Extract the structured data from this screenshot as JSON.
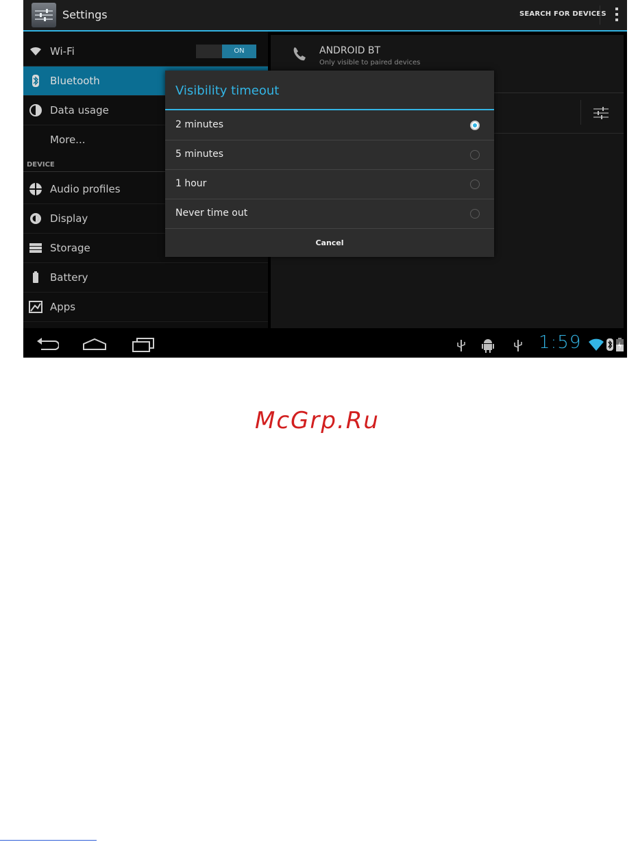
{
  "action_bar": {
    "title": "Settings",
    "search_label": "SEARCH FOR DEVICES"
  },
  "sidebar": {
    "wifi": {
      "label": "Wi-Fi",
      "toggle": "ON"
    },
    "items": [
      {
        "label": "Bluetooth",
        "selected": true
      },
      {
        "label": "Data usage"
      },
      {
        "label": "More..."
      }
    ],
    "device_header": "DEVICE",
    "device_items": [
      {
        "label": "Audio profiles"
      },
      {
        "label": "Display"
      },
      {
        "label": "Storage"
      },
      {
        "label": "Battery"
      },
      {
        "label": "Apps"
      }
    ]
  },
  "device_panel": {
    "name": "ANDROID BT",
    "subtitle": "Only visible to paired devices"
  },
  "dialog": {
    "title": "Visibility timeout",
    "options": [
      {
        "label": "2 minutes",
        "checked": true
      },
      {
        "label": "5 minutes",
        "checked": false
      },
      {
        "label": "1 hour",
        "checked": false
      },
      {
        "label": "Never time out",
        "checked": false
      }
    ],
    "cancel": "Cancel"
  },
  "status_bar": {
    "time": "1:59"
  },
  "watermark": "McGrp.Ru",
  "colors": {
    "accent": "#33b5e5",
    "selected_row": "#0b6e93",
    "watermark": "#d21f1f"
  }
}
